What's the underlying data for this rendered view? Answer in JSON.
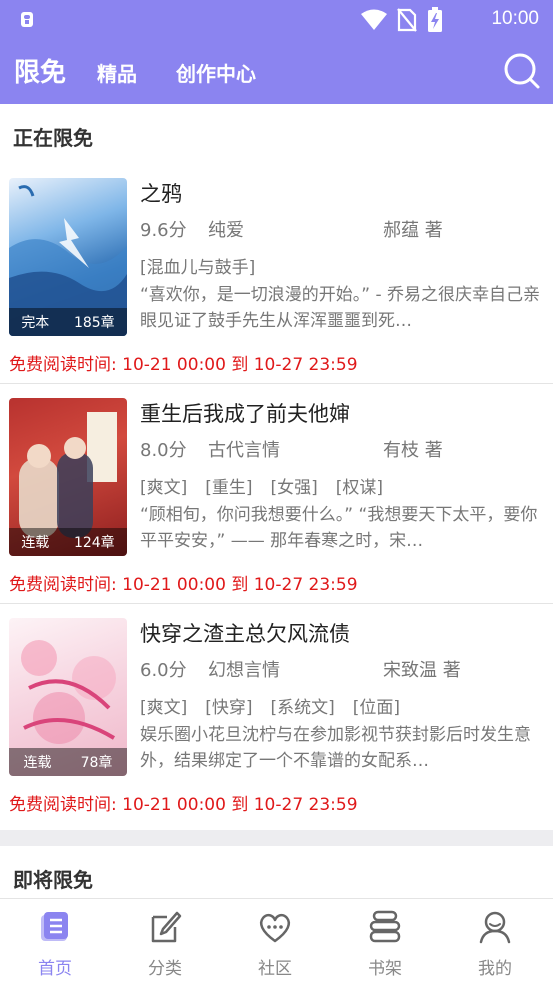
{
  "status_bar": {
    "time": "10:00"
  },
  "top_nav": {
    "tabs": [
      {
        "label": "限免",
        "active": true
      },
      {
        "label": "精品"
      },
      {
        "label": "创作中心"
      }
    ]
  },
  "section_free": {
    "title": "正在限免"
  },
  "books": [
    {
      "title": "之鸦",
      "score": "9.6分",
      "genre": "纯爱",
      "author": "郝蕴 著",
      "tags": [
        "[混血儿与鼓手]"
      ],
      "intro": "“喜欢你，是一切浪漫的开始。” - 乔易之很庆幸自己亲眼见证了鼓手先生从浑浑噩噩到死…",
      "status": "完本",
      "chapters": "185章",
      "free_time": "免费阅读时间: 10-21 00:00 到 10-27 23:59"
    },
    {
      "title": "重生后我成了前夫他婶",
      "score": "8.0分",
      "genre": "古代言情",
      "author": "有枝 著",
      "tags": [
        "[爽文]",
        "[重生]",
        "[女强]",
        "[权谋]"
      ],
      "intro": "“顾相旬，你问我想要什么。” “我想要天下太平，要你平平安安，” —— 那年春寒之时，宋…",
      "status": "连载",
      "chapters": "124章",
      "free_time": "免费阅读时间: 10-21 00:00 到 10-27 23:59"
    },
    {
      "title": "快穿之渣主总欠风流债",
      "score": "6.0分",
      "genre": "幻想言情",
      "author": "宋致温 著",
      "tags": [
        "[爽文]",
        "[快穿]",
        "[系统文]",
        "[位面]"
      ],
      "intro": "娱乐圈小花旦沈柠与在参加影视节获封影后时发生意外，结果绑定了一个不靠谱的女配系…",
      "status": "连载",
      "chapters": "78章",
      "free_time": "免费阅读时间: 10-21 00:00 到 10-27 23:59"
    }
  ],
  "section_upcoming": {
    "title": "即将限免"
  },
  "bottom_nav": [
    {
      "label": "首页",
      "icon": "home-book-icon",
      "active": true
    },
    {
      "label": "分类",
      "icon": "category-pen-icon"
    },
    {
      "label": "社区",
      "icon": "community-heart-icon"
    },
    {
      "label": "书架",
      "icon": "bookshelf-icon"
    },
    {
      "label": "我的",
      "icon": "profile-icon"
    }
  ],
  "colors": {
    "accent": "#8b84f0",
    "free_time": "#e0191a"
  }
}
